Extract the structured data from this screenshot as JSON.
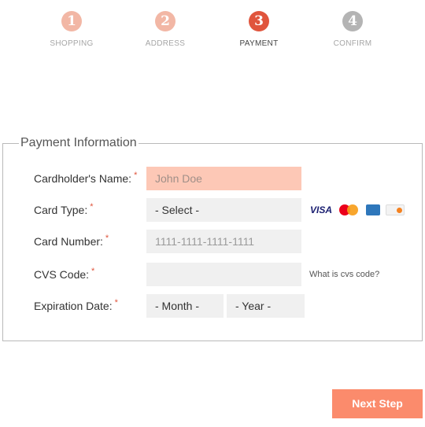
{
  "stepper": {
    "steps": [
      {
        "number": "1",
        "label": "SHOPPING",
        "state": "done"
      },
      {
        "number": "2",
        "label": "ADDRESS",
        "state": "done"
      },
      {
        "number": "3",
        "label": "PAYMENT",
        "state": "active"
      },
      {
        "number": "4",
        "label": "CONFIRM",
        "state": "todo"
      }
    ],
    "colors": {
      "done": "#f2b7a5",
      "active": "#e0553d",
      "todo": "#b4b4b4"
    }
  },
  "form": {
    "legend": "Payment Information",
    "required_mark": "*",
    "cardholder": {
      "label": "Cardholder's Name:",
      "placeholder": "John Doe"
    },
    "card_type": {
      "label": "Card Type:",
      "selected": "- Select -",
      "card_icons": [
        "visa-icon",
        "mastercard-icon",
        "amex-icon",
        "discover-icon"
      ],
      "visa_text": "VISA"
    },
    "card_number": {
      "label": "Card Number:",
      "placeholder": "1111-1111-1111-1111"
    },
    "cvs": {
      "label": "CVS Code:",
      "value": "",
      "help": "What is cvs code?"
    },
    "expiration": {
      "label": "Expiration Date:",
      "month": "- Month -",
      "year": "- Year -"
    }
  },
  "actions": {
    "next_label": "Next Step",
    "accent": "#fb8b6c"
  }
}
